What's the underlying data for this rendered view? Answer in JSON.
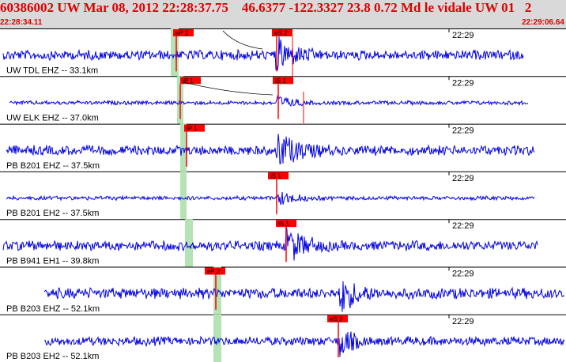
{
  "header": {
    "title": "60386002 UW Mar 08, 2012 22:28:37.75    46.6377 -122.3327 23.8 0.72 Md le vidale UW 01   2",
    "time_start": "22:28:34.11",
    "time_end": "22:29:06.64"
  },
  "colors": {
    "header_bg": "#d9d9d9",
    "header_text": "#e00000",
    "trace": "#0000e6",
    "pick": "#ff0000",
    "pick_window": "#b5e3b5",
    "channel_separator": "#000000"
  },
  "tick_label": "22:29",
  "channels": [
    {
      "label": "UW TDL EHZ -- 33.1km",
      "picks": [
        "eP 2",
        "eS 2"
      ],
      "amp": 1.0
    },
    {
      "label": "UW ELK EHZ -- 37.0km",
      "picks": [
        "iP 1",
        "iS 1"
      ],
      "amp": 0.4
    },
    {
      "label": "PB B201 EHZ -- 37.5km",
      "picks": [
        "iP 1"
      ],
      "amp": 1.0
    },
    {
      "label": "PB B201 EH2 -- 37.5km",
      "picks": [
        "iS 1"
      ],
      "amp": 0.4
    },
    {
      "label": "PB B941 EH1 -- 39.8km",
      "picks": [
        "iS 1"
      ],
      "amp": 1.0
    },
    {
      "label": "PB B203 EHZ -- 52.1km",
      "picks": [
        "eP 2"
      ],
      "amp": 1.1
    },
    {
      "label": "PB B203 EH2 -- 52.1km",
      "picks": [
        "eS 2"
      ],
      "amp": 0.9
    }
  ]
}
